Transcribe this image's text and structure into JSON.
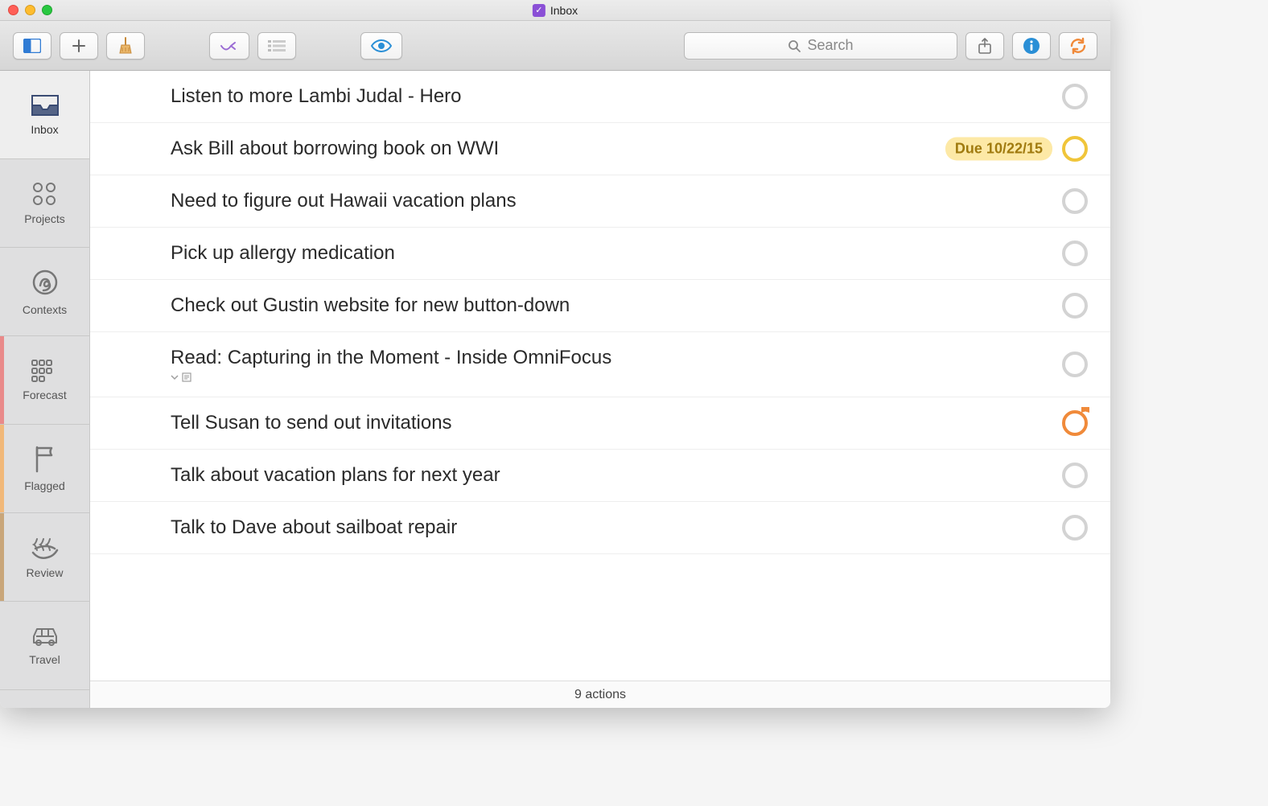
{
  "window": {
    "title": "Inbox"
  },
  "toolbar": {
    "search_placeholder": "Search"
  },
  "sidebar": {
    "items": [
      {
        "label": "Inbox"
      },
      {
        "label": "Projects"
      },
      {
        "label": "Contexts"
      },
      {
        "label": "Forecast"
      },
      {
        "label": "Flagged"
      },
      {
        "label": "Review"
      },
      {
        "label": "Travel"
      }
    ]
  },
  "tasks": [
    {
      "title": "Listen to more Lambi Judal - Hero",
      "status": "normal"
    },
    {
      "title": "Ask Bill about borrowing book on WWI",
      "status": "due",
      "due_tag": "Due 10/22/15"
    },
    {
      "title": "Need to figure out Hawaii vacation plans",
      "status": "normal"
    },
    {
      "title": "Pick up allergy medication",
      "status": "normal"
    },
    {
      "title": "Check out Gustin website for new button-down",
      "status": "normal"
    },
    {
      "title": "Read: Capturing in the Moment - Inside OmniFocus",
      "status": "normal",
      "has_note": true
    },
    {
      "title": "Tell Susan to send out invitations",
      "status": "flagged"
    },
    {
      "title": "Talk about vacation plans for next year",
      "status": "normal"
    },
    {
      "title": "Talk to Dave about sailboat repair",
      "status": "normal"
    }
  ],
  "statusbar": {
    "summary": "9 actions"
  }
}
